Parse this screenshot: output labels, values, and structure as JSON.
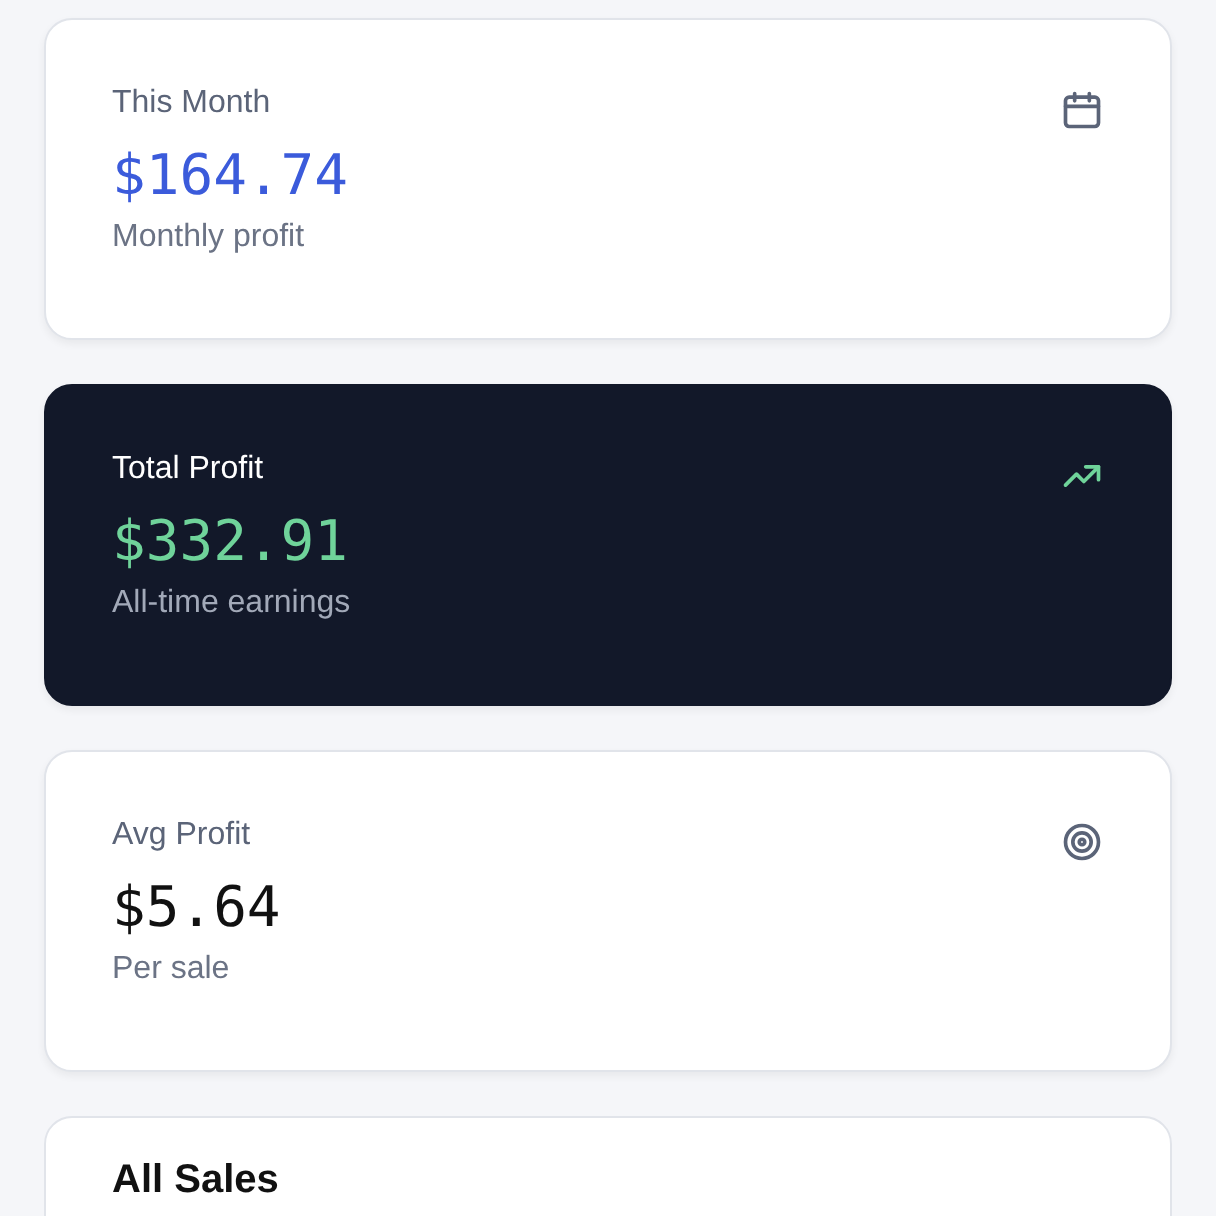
{
  "cards": [
    {
      "kind": "accent",
      "title": "This Month",
      "value": "$164.74",
      "caption": "Monthly profit"
    },
    {
      "kind": "dark",
      "title": "Total Profit",
      "value": "$332.91",
      "caption": "All-time earnings"
    },
    {
      "kind": "plain",
      "title": "Avg Profit",
      "value": "$5.64",
      "caption": "Per sale"
    }
  ],
  "sales_panel": {
    "title": "All Sales"
  }
}
